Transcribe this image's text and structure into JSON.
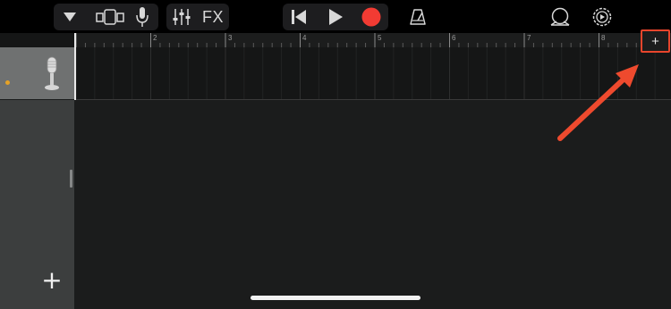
{
  "toolbar": {
    "fx_label": "FX"
  },
  "ruler": {
    "bars": [
      "2",
      "3",
      "4",
      "5",
      "6",
      "7",
      "8"
    ],
    "add_section_label": "+"
  },
  "track": {
    "icon": "microphone-icon",
    "indicator_color": "#e5a227"
  },
  "side_panel": {
    "add_track_label": "+"
  },
  "annotation": {
    "arrow_color": "#ee4a2e"
  },
  "colors": {
    "record": "#f23b33",
    "toolbar_bg": "#000000",
    "track_header": "#6f7171"
  }
}
